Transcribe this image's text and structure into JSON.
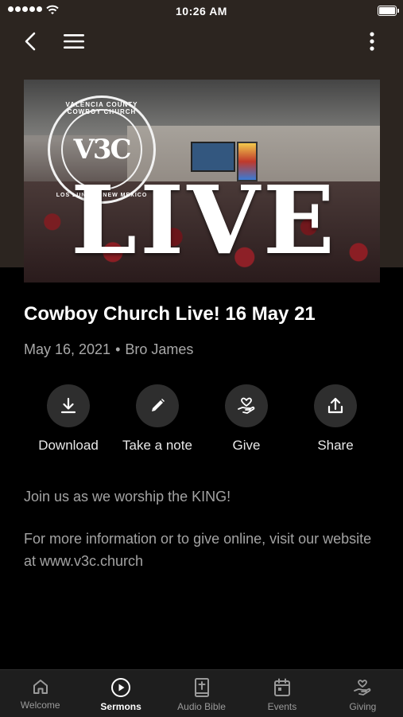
{
  "status_bar": {
    "time": "10:26 AM"
  },
  "hero": {
    "seal_top": "VALENCIA COUNTY COWBOY CHURCH",
    "seal_center": "V3C",
    "seal_bottom": "LOS LUNAS · NEW MEXICO",
    "overlay_text": "LIVE"
  },
  "sermon": {
    "title": "Cowboy Church Live! 16 May 21",
    "date": "May 16, 2021",
    "separator": "•",
    "speaker": "Bro James"
  },
  "actions": [
    {
      "label": "Download",
      "icon": "download-icon"
    },
    {
      "label": "Take a note",
      "icon": "pencil-icon"
    },
    {
      "label": "Give",
      "icon": "heart-hand-icon"
    },
    {
      "label": "Share",
      "icon": "share-icon"
    }
  ],
  "description": {
    "line1": "Join us as we worship the KING!",
    "line2": "For more information or to give online, visit our website at www.v3c.church"
  },
  "tabs": [
    {
      "label": "Welcome",
      "icon": "home-icon",
      "active": false
    },
    {
      "label": "Sermons",
      "icon": "play-circle-icon",
      "active": true
    },
    {
      "label": "Audio Bible",
      "icon": "bible-icon",
      "active": false
    },
    {
      "label": "Events",
      "icon": "calendar-icon",
      "active": false
    },
    {
      "label": "Giving",
      "icon": "giving-icon",
      "active": false
    }
  ],
  "colors": {
    "header_bg": "#2c2520",
    "page_bg": "#000000",
    "tabbar_bg": "#1e1e1e",
    "action_circle": "#2e2e2e"
  }
}
